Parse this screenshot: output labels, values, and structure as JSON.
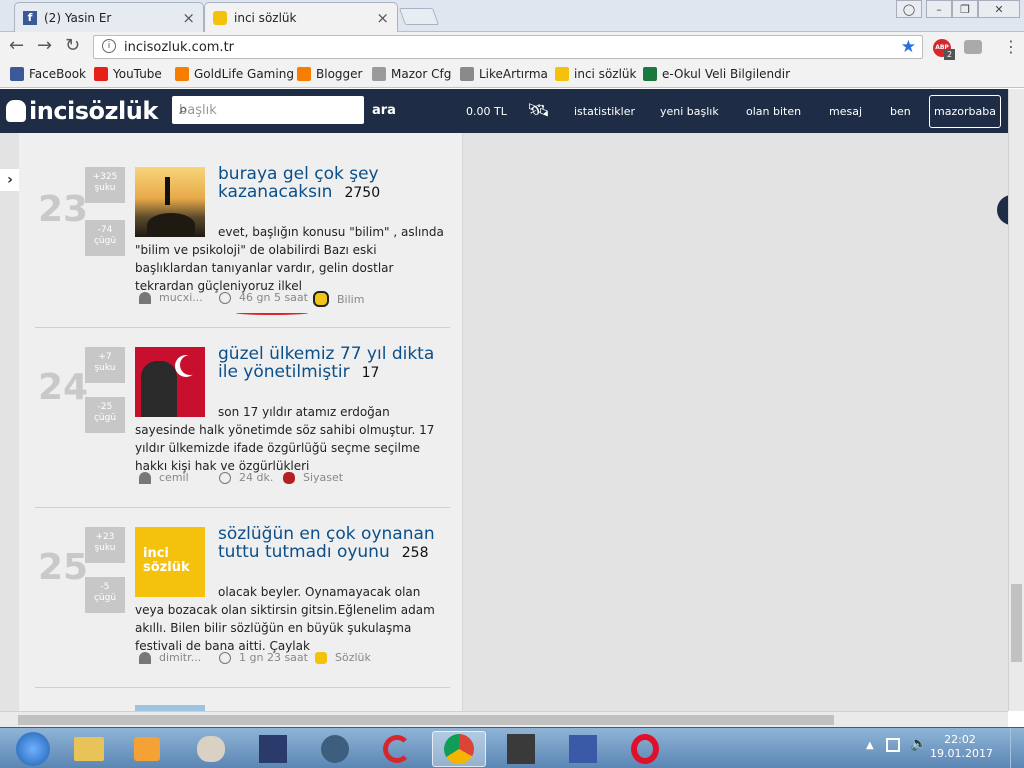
{
  "browser": {
    "tabs": [
      {
        "title": "(2) Yasin Er",
        "favicon": "facebook-icon",
        "close": "×"
      },
      {
        "title": "inci sözlük",
        "favicon": "inci-icon",
        "close": "×"
      }
    ],
    "window_buttons": [
      "minimize",
      "restore",
      "close"
    ],
    "url": "incisozluk.com.tr",
    "extension_badge": "2",
    "extension_abbr": "ABP"
  },
  "bookmarks": [
    {
      "label": "FaceBook",
      "icon": "facebook-icon",
      "color": "#3b5998"
    },
    {
      "label": "YouTube",
      "icon": "youtube-icon",
      "color": "#e62117"
    },
    {
      "label": "GoldLife Gaming",
      "icon": "blogger-icon",
      "color": "#f57d00"
    },
    {
      "label": "Blogger",
      "icon": "blogger-icon",
      "color": "#f57d00"
    },
    {
      "label": "Mazor Cfg",
      "icon": "tools-icon",
      "color": "#999999"
    },
    {
      "label": "LikeArtırma",
      "icon": "y-icon",
      "color": "#8a8a8a"
    },
    {
      "label": "inci sözlük",
      "icon": "inci-icon",
      "color": "#f4c20d"
    },
    {
      "label": "e-Okul Veli Bilgilendir",
      "icon": "eokul-icon",
      "color": "#1a7a3e"
    }
  ],
  "site": {
    "logo": "incisözlük",
    "search_placeholder": "başlık",
    "search_button": "ara",
    "balance": "0.00 TL",
    "nav": [
      "istatistikler",
      "yeni başlık",
      "olan biten",
      "mesaj",
      "ben"
    ],
    "user": "mazorbaba",
    "brand_color": "#1e2d45"
  },
  "entries": [
    {
      "rank": "23",
      "up": "+325",
      "up_label": "şuku",
      "down": "-74",
      "down_label": "çügü",
      "title": "buraya gel çok şey kazanacaksın",
      "count": "2750",
      "body": "evet, başlığın konusu \"bilim\" , aslında \"bilim ve psikoloji\" de olabilirdi Bazı eski başlıklardan tanıyanlar vardır, gelin dostlar tekrardan güçleniyoruz ilkel",
      "author": "mucxi...",
      "time": "46 gn 5 saat",
      "channel": "Bilim",
      "thumb": "mountain-silhouette"
    },
    {
      "rank": "24",
      "up": "+7",
      "up_label": "şuku",
      "down": "-25",
      "down_label": "çügü",
      "title": "güzel ülkemiz 77 yıl dikta ile yönetilmiştir",
      "count": "17",
      "body": "son 17 yıldır atamız erdoğan sayesinde halk yönetimde söz sahibi olmuştur. 17 yıldır ülkemizde ifade özgürlüğü seçme seçilme hakkı kişi hak ve özgürlükleri",
      "author": "cemil",
      "time": "24 dk.",
      "channel": "Siyaset",
      "thumb": "flag-portrait"
    },
    {
      "rank": "25",
      "up": "+23",
      "up_label": "şuku",
      "down": "-5",
      "down_label": "çügü",
      "title": "sözlüğün en çok oynanan tuttu tutmadı oyunu",
      "count": "258",
      "body": "olacak beyler. Oynamayacak olan veya bozacak olan siktirsin gitsin.Eğlenelim adam akıllı. Bilen bilir sözlüğün en büyük şukulaşma festivali de bana aitti. Çaylak",
      "author": "dimitr...",
      "time": "1 gn 23 saat",
      "channel": "Sözlük",
      "thumb": "inci-sozluk-logo",
      "thumb_text": "inci sözlük"
    }
  ],
  "taskbar": {
    "apps": [
      "start-orb",
      "explorer-icon",
      "media-player-icon",
      "paint-icon",
      "photo-editor-icon",
      "teamspeak-icon",
      "ccleaner-icon",
      "chrome-icon",
      "counter-strike-icon",
      "game-icon",
      "opera-icon"
    ],
    "time": "22:02",
    "date": "19.01.2017"
  }
}
